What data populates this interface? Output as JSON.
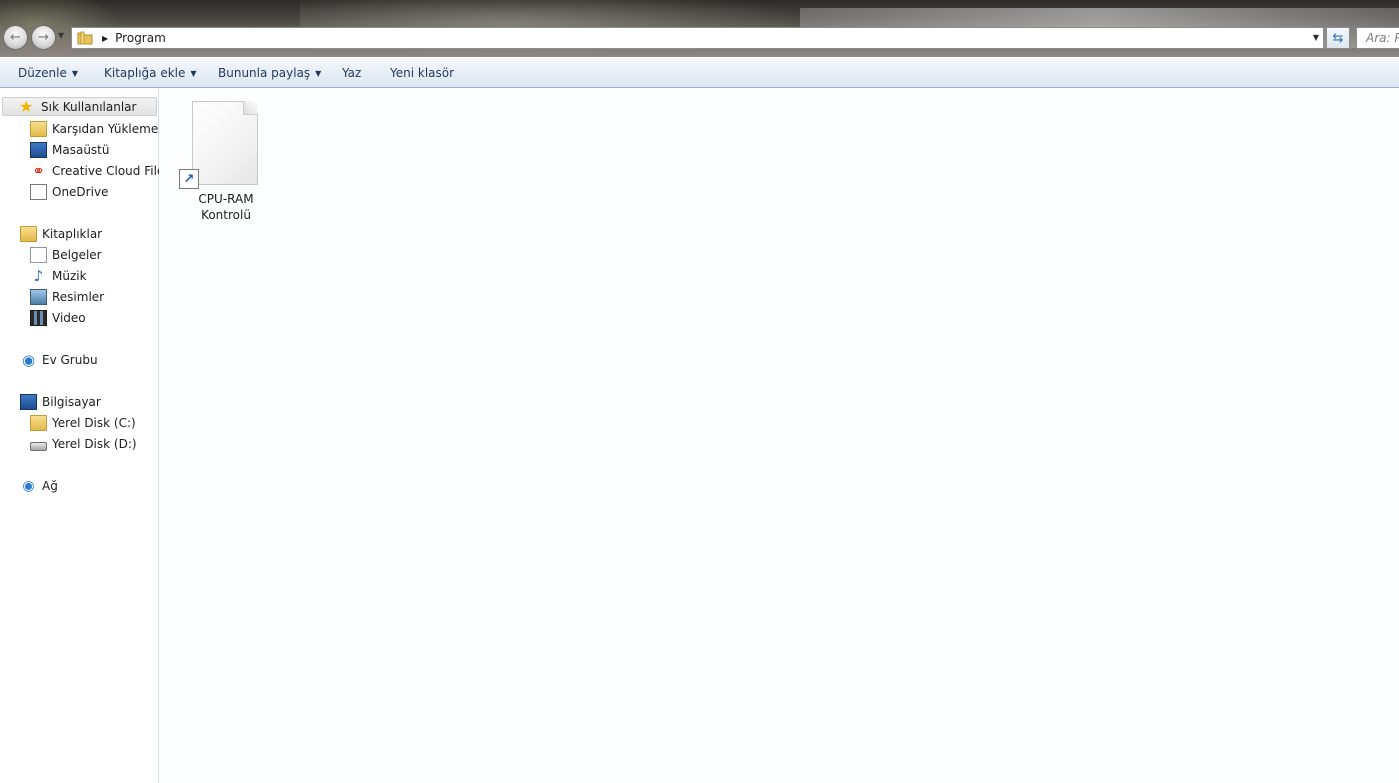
{
  "address": {
    "path_segment": "Program",
    "search_placeholder": "Ara: P"
  },
  "icons": {
    "back": "back-arrow-icon",
    "forward": "forward-arrow-icon",
    "refresh": "refresh-icon",
    "folder": "folder-icon"
  },
  "commandbar": {
    "organize": "Düzenle",
    "include_in_library": "Kitaplığa ekle",
    "share_with": "Bununla paylaş",
    "burn": "Yaz",
    "new_folder": "Yeni klasör"
  },
  "navpane": {
    "favorites": {
      "label": "Sık Kullanılanlar",
      "items": [
        {
          "label": "Karşıdan Yüklemeler",
          "icon": "downloads-folder-icon"
        },
        {
          "label": "Masaüstü",
          "icon": "desktop-icon"
        },
        {
          "label": "Creative Cloud Files",
          "icon": "creative-cloud-icon"
        },
        {
          "label": "OneDrive",
          "icon": "onedrive-icon"
        }
      ]
    },
    "libraries": {
      "label": "Kitaplıklar",
      "items": [
        {
          "label": "Belgeler",
          "icon": "documents-icon"
        },
        {
          "label": "Müzik",
          "icon": "music-icon"
        },
        {
          "label": "Resimler",
          "icon": "pictures-icon"
        },
        {
          "label": "Video",
          "icon": "video-icon"
        }
      ]
    },
    "homegroup": {
      "label": "Ev Grubu"
    },
    "computer": {
      "label": "Bilgisayar",
      "items": [
        {
          "label": "Yerel Disk (C:)",
          "icon": "system-drive-icon"
        },
        {
          "label": "Yerel Disk (D:)",
          "icon": "drive-icon"
        }
      ]
    },
    "network": {
      "label": "Ağ"
    }
  },
  "content": {
    "files": [
      {
        "name_line1": "CPU-RAM",
        "name_line2": "Kontrolü",
        "type": "shortcut"
      }
    ]
  },
  "colors": {
    "command_text": "#1e395b",
    "accent_blue": "#2f6fb5"
  }
}
